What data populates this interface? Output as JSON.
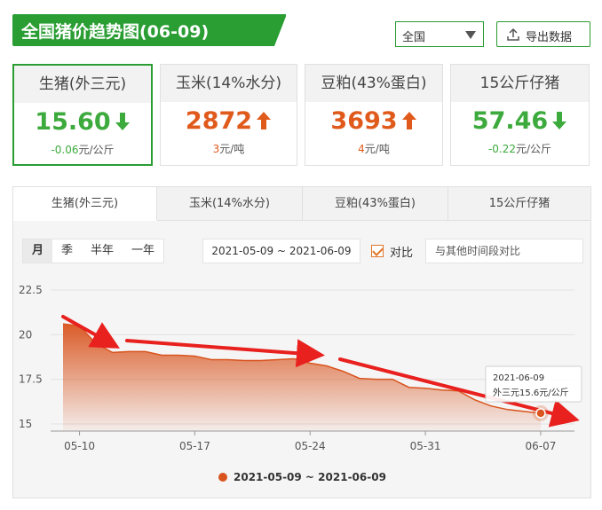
{
  "header": {
    "title": "全国猪价趋势图(06-09)",
    "region_value": "全国",
    "export_label": "导出数据"
  },
  "cards": [
    {
      "name": "生猪(外三元)",
      "price": "15.60",
      "direction": "down",
      "change": "-0.06",
      "unit": "元/公斤"
    },
    {
      "name": "玉米(14%水分)",
      "price": "2872",
      "direction": "up",
      "change": "3",
      "unit": "元/吨"
    },
    {
      "name": "豆粕(43%蛋白)",
      "price": "3693",
      "direction": "up",
      "change": "4",
      "unit": "元/吨"
    },
    {
      "name": "15公斤仔猪",
      "price": "57.46",
      "direction": "down",
      "change": "-0.22",
      "unit": "元/公斤"
    }
  ],
  "tabs": [
    "生猪(外三元)",
    "玉米(14%水分)",
    "豆粕(43%蛋白)",
    "15公斤仔猪"
  ],
  "period_buttons": [
    "月",
    "季",
    "半年",
    "一年"
  ],
  "date_range": "2021-05-09 ~ 2021-06-09",
  "compare_label": "对比",
  "compare_placeholder": "与其他时间段对比",
  "colors": {
    "green": "#2a9d33",
    "down": "#3daa3d",
    "up": "#e05a1c",
    "series": "#d9541e",
    "annotation_arrow": "#e8211e"
  },
  "chart_data": {
    "type": "area",
    "yticks": [
      "22.5",
      "20",
      "17.5",
      "15"
    ],
    "ylim": [
      14.6,
      22.5
    ],
    "xticks": [
      {
        "label": "05-10",
        "day": 1
      },
      {
        "label": "05-17",
        "day": 8
      },
      {
        "label": "05-24",
        "day": 15
      },
      {
        "label": "05-31",
        "day": 22
      },
      {
        "label": "06-07",
        "day": 29
      }
    ],
    "series": [
      {
        "name": "2021-05-09 ~ 2021-06-09",
        "values": [
          20.6,
          20.5,
          19.5,
          19.0,
          19.05,
          19.05,
          18.85,
          18.85,
          18.8,
          18.6,
          18.6,
          18.55,
          18.55,
          18.6,
          18.65,
          18.4,
          18.25,
          17.95,
          17.55,
          17.5,
          17.5,
          17.05,
          17.0,
          16.9,
          16.85,
          16.35,
          16.0,
          15.8,
          15.7,
          15.6
        ]
      }
    ],
    "tooltip": {
      "date": "2021-06-09",
      "label": "外三元15.6元/公斤"
    }
  }
}
